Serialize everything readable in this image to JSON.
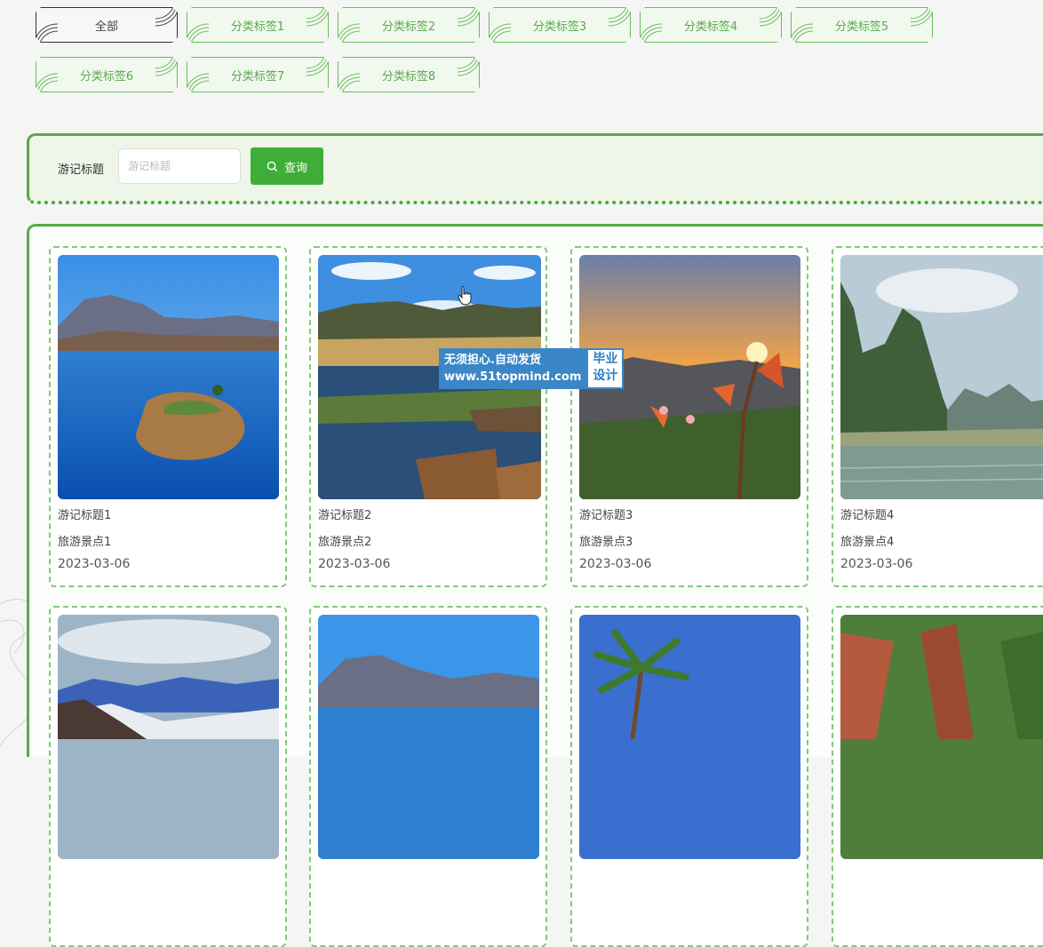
{
  "categories": {
    "all": "全部",
    "items": [
      "分类标签1",
      "分类标签2",
      "分类标签3",
      "分类标签4",
      "分类标签5",
      "分类标签6",
      "分类标签7",
      "分类标签8"
    ]
  },
  "search": {
    "label": "游记标题",
    "placeholder": "游记标题",
    "value": "",
    "button_label": "查询"
  },
  "cards": [
    {
      "title": "游记标题1",
      "spot": "旅游景点1",
      "date": "2023-03-06"
    },
    {
      "title": "游记标题2",
      "spot": "旅游景点2",
      "date": "2023-03-06"
    },
    {
      "title": "游记标题3",
      "spot": "旅游景点3",
      "date": "2023-03-06"
    },
    {
      "title": "游记标题4",
      "spot": "旅游景点4",
      "date": "2023-03-06"
    }
  ],
  "watermark": {
    "line1": "无须担心.自动发货",
    "line2": "www.51topmind.com",
    "badge1": "毕业",
    "badge2": "设计"
  },
  "colors": {
    "accent": "#3fae38",
    "tag_text": "#5aa84d",
    "tag_border": "#6bbb5e"
  }
}
